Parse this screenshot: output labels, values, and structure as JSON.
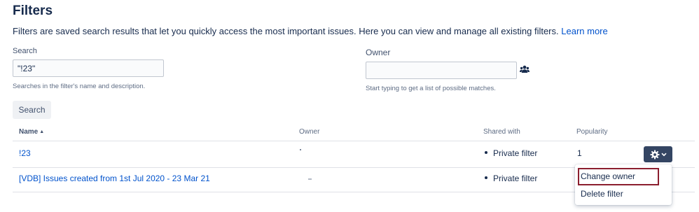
{
  "page": {
    "title": "Filters",
    "intro_text": "Filters are saved search results that let you quickly access the most important issues. Here you can view and manage all existing filters.",
    "learn_more": "Learn more"
  },
  "search": {
    "label": "Search",
    "value": "\"!23\"",
    "hint": "Searches in the filter's name and description.",
    "button": "Search"
  },
  "owner": {
    "label": "Owner",
    "value": "",
    "hint": "Start typing to get a list of possible matches.",
    "icon": "people-icon"
  },
  "table": {
    "columns": {
      "name": "Name",
      "owner": "Owner",
      "shared": "Shared with",
      "popularity": "Popularity"
    },
    "rows": [
      {
        "name": "!23",
        "shared": "Private filter",
        "popularity": "1"
      },
      {
        "name": "[VDB] Issues created from 1st Jul 2020 - 23 Mar 21",
        "shared": "Private filter",
        "popularity": ""
      }
    ]
  },
  "actions_menu": {
    "items": [
      "Change owner",
      "Delete filter"
    ],
    "highlight_color": "#8b1e2e"
  },
  "colors": {
    "link": "#0052cc",
    "text": "#172b4d",
    "gear_button": "#344563"
  }
}
